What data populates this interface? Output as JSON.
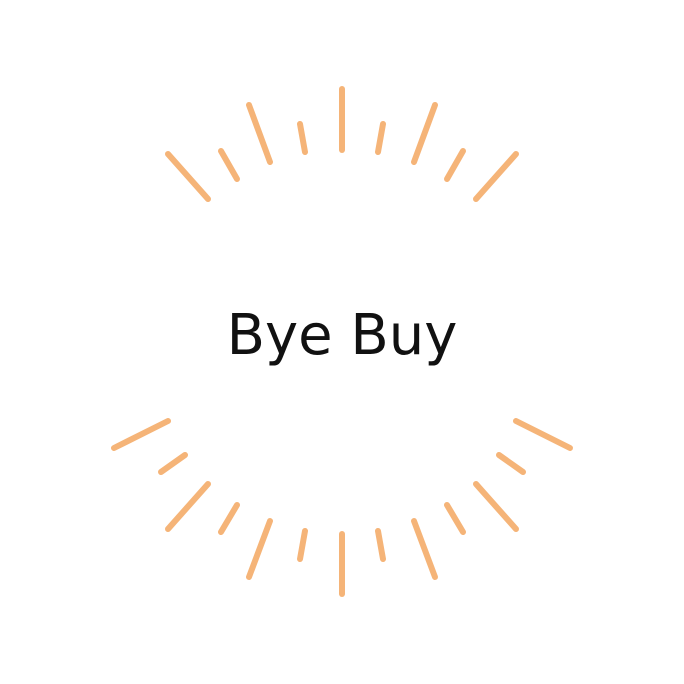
{
  "brand": {
    "name": "Bye Buy",
    "text_color": "#111111"
  },
  "decoration": {
    "ray_color": "#F5B478",
    "background": "#FFFFFF"
  }
}
